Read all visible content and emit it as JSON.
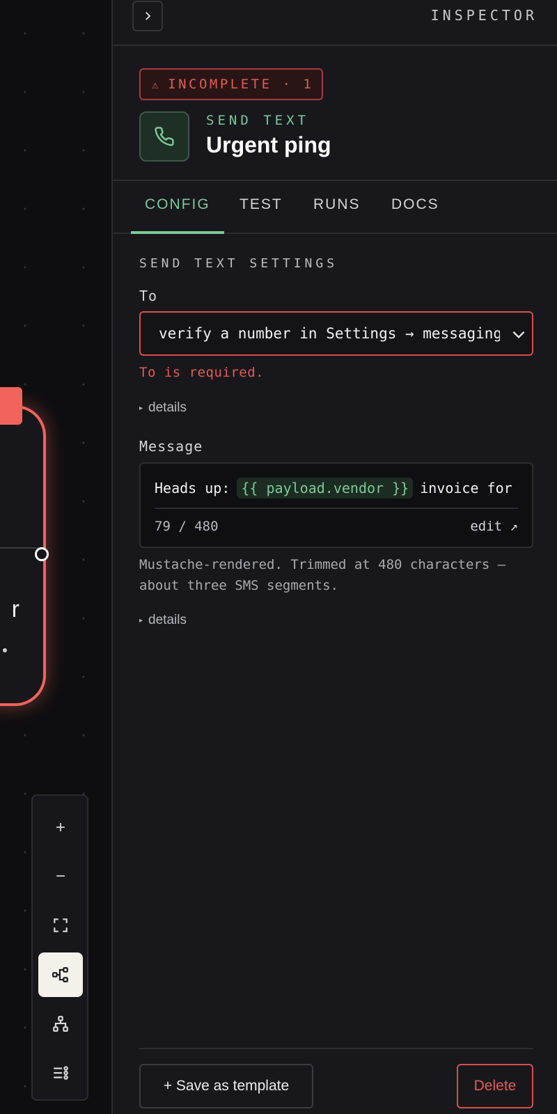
{
  "canvas": {
    "node_glyph": "r",
    "toolbar": {
      "buttons": [
        {
          "icon": "plus-icon",
          "glyph": "+"
        },
        {
          "icon": "minus-icon",
          "glyph": "−"
        },
        {
          "icon": "fit-view-icon"
        },
        {
          "icon": "flow-layout-icon",
          "active": true
        },
        {
          "icon": "tree-layout-icon"
        },
        {
          "icon": "list-settings-icon"
        }
      ]
    }
  },
  "inspector": {
    "title": "INSPECTOR",
    "collapse_icon": "chevron-right-icon",
    "status": {
      "icon": "warning-icon",
      "glyph": "⚠",
      "label": "INCOMPLETE · 1"
    },
    "node": {
      "icon": "phone-icon",
      "type": "SEND TEXT",
      "name": "Urgent ping"
    },
    "tabs": [
      {
        "label": "CONFIG",
        "active": true
      },
      {
        "label": "TEST"
      },
      {
        "label": "RUNS"
      },
      {
        "label": "DOCS"
      }
    ],
    "section_title": "SEND TEXT SETTINGS",
    "to": {
      "label": "To",
      "value": "verify a number in Settings → messaging",
      "error": "To is required.",
      "details_label": "details"
    },
    "message": {
      "label": "Message",
      "prefix": "Heads up:",
      "token": "{{ payload.vendor }}",
      "suffix": "invoice for",
      "count": "79 / 480",
      "edit_label": "edit ↗",
      "help": "Mustache-rendered. Trimmed at 480 characters — about three SMS segments.",
      "details_label": "details"
    },
    "footer": {
      "save_template_label": "+ Save as template",
      "delete_label": "Delete"
    }
  },
  "colors": {
    "accent_green": "#7cc99a",
    "error_red": "#e05c56",
    "node_border": "#f0645c",
    "background": "#18181c"
  }
}
